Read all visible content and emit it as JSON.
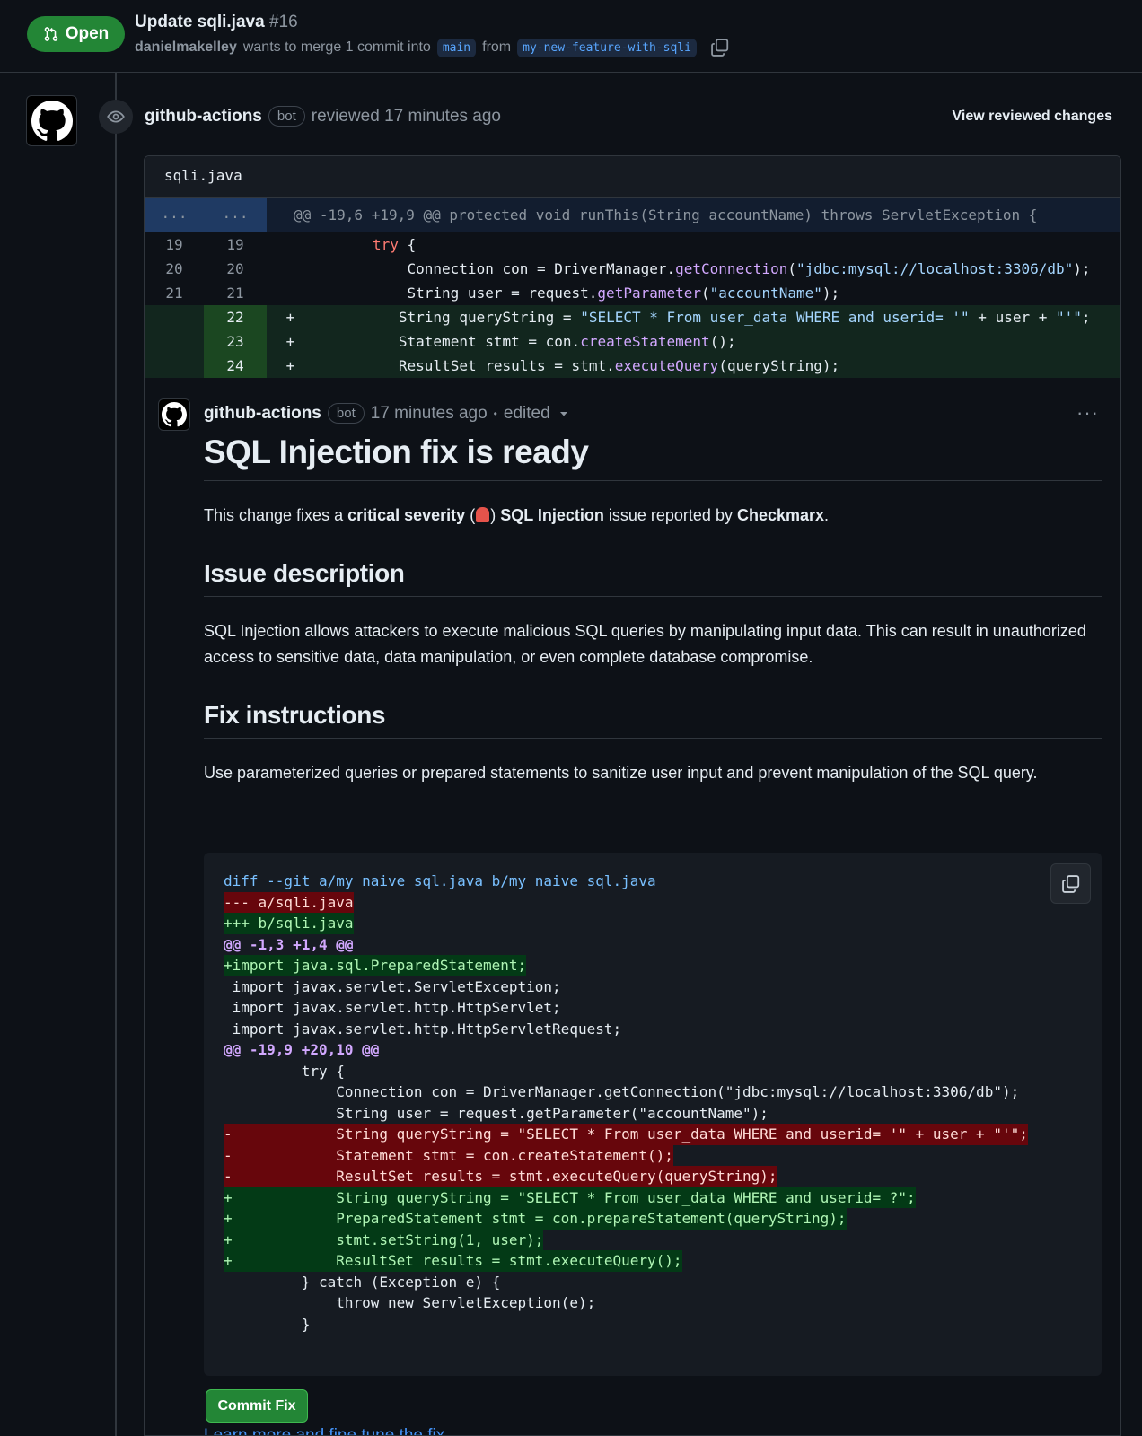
{
  "header": {
    "status": "Open",
    "title": "Update sqli.java",
    "number": "#16",
    "author": "danielmakelley",
    "meta_text": "wants to merge 1 commit into",
    "base_branch": "main",
    "from_text": "from",
    "head_branch": "my-new-feature-with-sqli"
  },
  "review": {
    "reviewer": "github-actions",
    "bot_label": "bot",
    "action": "reviewed 17 minutes ago",
    "view_changes": "View reviewed changes"
  },
  "diff": {
    "filename": "sqli.java",
    "hunk_dots_left": "...",
    "hunk_dots_right": "...",
    "hunk_header": "@@ -19,6 +19,9 @@ protected void runThis(String accountName) throws ServletException {",
    "lines": [
      {
        "old": "19",
        "new": "19",
        "sign": " ",
        "indent": "        ",
        "kw": "try",
        "rest": " {"
      },
      {
        "old": "20",
        "new": "20",
        "sign": " ",
        "indent": "            ",
        "a": "Connection con = DriverManager.",
        "fn": "getConnection",
        "b": "(",
        "str": "\"jdbc:mysql://localhost:3306/db\"",
        "c": ");"
      },
      {
        "old": "21",
        "new": "21",
        "sign": " ",
        "indent": "            ",
        "a": "String user = request.",
        "fn": "getParameter",
        "b": "(",
        "str": "\"accountName\"",
        "c": ");"
      },
      {
        "old": "",
        "new": "22",
        "sign": "+",
        "indent": "           ",
        "a": "String queryString = ",
        "str": "\"SELECT * From user_data WHERE and userid= '\"",
        "c": " + user + ",
        "str2": "\"'\"",
        "d": ";"
      },
      {
        "old": "",
        "new": "23",
        "sign": "+",
        "indent": "           ",
        "a": "Statement stmt = con.",
        "fn": "createStatement",
        "c": "();"
      },
      {
        "old": "",
        "new": "24",
        "sign": "+",
        "indent": "           ",
        "a": "ResultSet results = stmt.",
        "fn": "executeQuery",
        "c": "(queryString);"
      }
    ]
  },
  "comment": {
    "author": "github-actions",
    "bot_label": "bot",
    "time": "17 minutes ago",
    "separator": "•",
    "edited": "edited",
    "more": "···",
    "title": "SQL Injection fix is ready",
    "intro_1": "This change fixes a ",
    "intro_severity": "critical severity",
    "intro_2": " (",
    "intro_3": ") ",
    "intro_issue": "SQL Injection",
    "intro_4": " issue reported by ",
    "intro_tool": "Checkmarx",
    "intro_5": ".",
    "issue_heading": "Issue description",
    "issue_text": "SQL Injection allows attackers to execute malicious SQL queries by manipulating input data. This can result in unauthorized access to sensitive data, data manipulation, or even complete database compromise.",
    "fix_heading": "Fix instructions",
    "fix_text": "Use parameterized queries or prepared statements to sanitize user input and prevent manipulation of the SQL query.",
    "code_lines": [
      {
        "t": "meta",
        "text": "diff --git a/my naive sql.java b/my naive sql.java"
      },
      {
        "t": "del",
        "text": "--- a/sqli.java"
      },
      {
        "t": "add",
        "text": "+++ b/sqli.java"
      },
      {
        "t": "hunk",
        "text": "@@ -1,3 +1,4 @@"
      },
      {
        "t": "add",
        "text": "+import java.sql.PreparedStatement;"
      },
      {
        "t": "ctx",
        "text": " import javax.servlet.ServletException;"
      },
      {
        "t": "ctx",
        "text": " import javax.servlet.http.HttpServlet;"
      },
      {
        "t": "ctx",
        "text": " import javax.servlet.http.HttpServletRequest;"
      },
      {
        "t": "hunk",
        "text": "@@ -19,9 +20,10 @@"
      },
      {
        "t": "ctx",
        "text": "         try {"
      },
      {
        "t": "ctx",
        "text": "             Connection con = DriverManager.getConnection(\"jdbc:mysql://localhost:3306/db\");"
      },
      {
        "t": "ctx",
        "text": "             String user = request.getParameter(\"accountName\");"
      },
      {
        "t": "del",
        "text": "-            String queryString = \"SELECT * From user_data WHERE and userid= '\" + user + \"'\";"
      },
      {
        "t": "del",
        "text": "-            Statement stmt = con.createStatement();"
      },
      {
        "t": "del",
        "text": "-            ResultSet results = stmt.executeQuery(queryString);"
      },
      {
        "t": "add",
        "text": "+            String queryString = \"SELECT * From user_data WHERE and userid= ?\";"
      },
      {
        "t": "add",
        "text": "+            PreparedStatement stmt = con.prepareStatement(queryString);"
      },
      {
        "t": "add",
        "text": "+            stmt.setString(1, user);"
      },
      {
        "t": "add",
        "text": "+            ResultSet results = stmt.executeQuery();"
      },
      {
        "t": "ctx",
        "text": "         } catch (Exception e) {"
      },
      {
        "t": "ctx",
        "text": "             throw new ServletException(e);"
      },
      {
        "t": "ctx",
        "text": "         }"
      }
    ],
    "commit_button": "Commit Fix",
    "learn_link": "Learn more and fine tune the fix"
  },
  "colors": {
    "open_green": "#238636",
    "link_blue": "#4493f8",
    "add_bg": "#033a16",
    "del_bg": "#67060c"
  }
}
